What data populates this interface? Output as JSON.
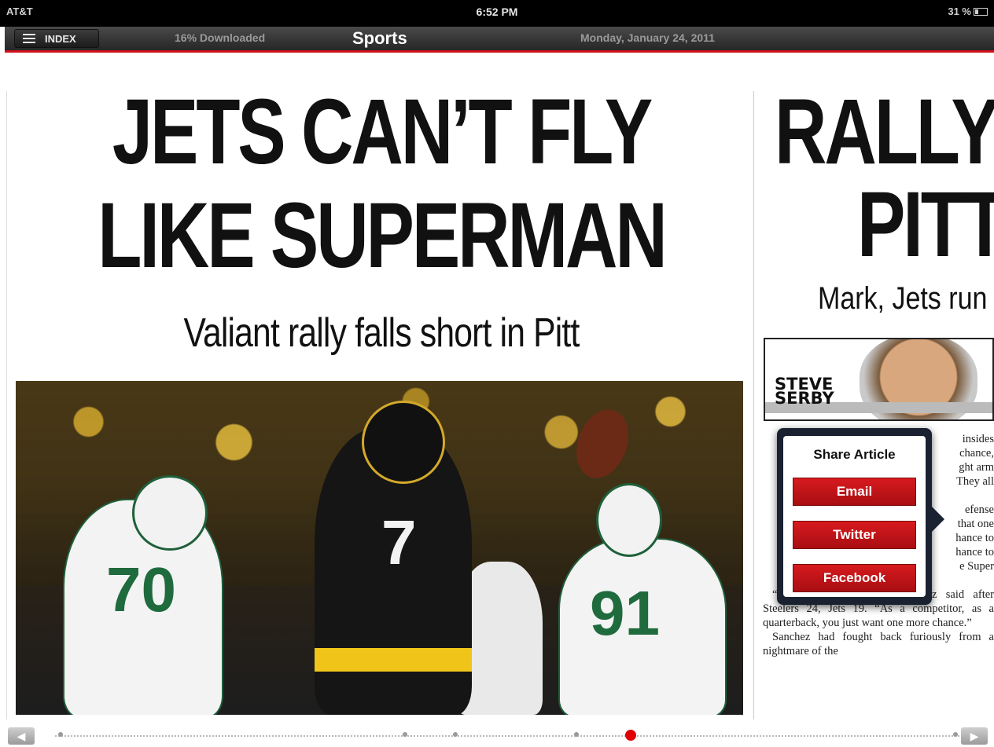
{
  "status_bar": {
    "carrier": "AT&T",
    "time": "6:52 PM",
    "battery": "31 %"
  },
  "app_bar": {
    "index_label": "INDEX",
    "download_status": "16% Downloaded",
    "section": "Sports",
    "date": "Monday, January 24, 2011"
  },
  "left_story": {
    "headline_line1": "JETS CAN’T FLY",
    "headline_line2": "LIKE SUPERMAN",
    "subhead": "Valiant rally falls short in Pitt",
    "photo_numbers": [
      "70",
      "7",
      "91"
    ]
  },
  "right_story": {
    "headline_line1": "RALLY",
    "headline_line2": "PITT",
    "subhead": "Mark, Jets run",
    "columnist_line1": "STEVE",
    "columnist_line2": "SERBY",
    "paragraph_fragments": [
      "insides",
      "chance,",
      "ght arm",
      "They all",
      "efense",
      "that one",
      "hance to",
      "hance to",
      "e Super"
    ],
    "paragraph2": "“That's all you want,” Sanchez said after Steelers 24, Jets 19. “As a competitor, as a quarterback, you just want one more chance.”",
    "paragraph3": "Sanchez had fought back furiously from a nightmare of the"
  },
  "share_popover": {
    "title": "Share Article",
    "buttons": [
      "Email",
      "Twitter",
      "Facebook"
    ]
  },
  "colors": {
    "accent_red": "#d71a1f",
    "popover_frame": "#1a2232"
  },
  "icons": [
    "index-list-icon",
    "wifi-icon",
    "battery-icon",
    "prev-arrow-icon",
    "next-arrow-icon"
  ]
}
